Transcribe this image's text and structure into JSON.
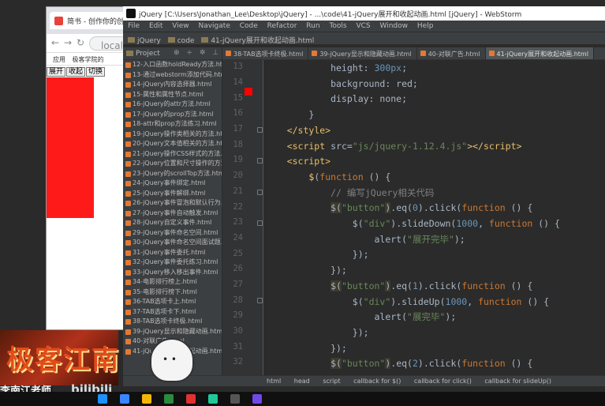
{
  "browser": {
    "tab_title": "简书 - 创作你的创作",
    "url_text": "localh",
    "bookmarks": [
      "应用",
      "极客学院的"
    ],
    "buttons": [
      "展开",
      "收起",
      "切换"
    ]
  },
  "ide": {
    "title": "jQuery [C:\\Users\\Jonathan_Lee\\Desktop\\jQuery] - ...\\code\\41-jQuery展开和收起动画.html [jQuery] - WebStorm",
    "menu": [
      "File",
      "Edit",
      "View",
      "Navigate",
      "Code",
      "Refactor",
      "Run",
      "Tools",
      "VCS",
      "Window",
      "Help"
    ],
    "nav_breadcrumbs": [
      "jQuery",
      "code",
      "41-jQuery展开和收起动画.html"
    ],
    "project_label": "Project",
    "project_tools": "⊕ ÷ ✲ ⊥",
    "files": [
      "12-入口函数holdReady方法.html",
      "13-通过webstorm添加代码.html",
      "14-jQuery内容选择器.html",
      "15-属性和属性节点.html",
      "16-jQuery的attr方法.html",
      "17-jQuery的prop方法.html",
      "18-attr和prop方法练习.html",
      "19-jQuery操作类相关的方法.html",
      "20-jQuery文本值相关的方法.html",
      "21-jQuery操作CSS样式的方法.ht",
      "22-jQuery位置和尺寸操作的方法.ht",
      "23-jQuery的scrollTop方法.html",
      "24-jQuery事件绑定.html",
      "25-jQuery事件解绑.html",
      "26-jQuery事件冒泡和默认行为.html",
      "27-jQuery事件自动触发.html",
      "28-jQuery自定义事件.html",
      "29-jQuery事件命名空间.html",
      "30-jQuery事件命名空间面试题.htm",
      "31-jQuery事件委托.html",
      "32-jQuery事件委托练习.html",
      "33-jQuery移入移出事件.html",
      "34-电影排行榜上.html",
      "35-电影排行榜下.html",
      "36-TAB选项卡上.html",
      "37-TAB选项卡下.html",
      "38-TAB选项卡终极.html",
      "39-jQuery显示和隐藏动画.html",
      "40-对联广告.html",
      "41-jQuery展开和收起动画.html"
    ],
    "tabs": [
      "38-TAB选项卡终极.html",
      "39-jQuery显示和隐藏动画.html",
      "40-对联广告.html",
      "41-jQuery展开和收起动画.html"
    ],
    "active_tab_index": 3,
    "line_numbers": [
      "13",
      "14",
      "15",
      "16",
      "17",
      "18",
      "19",
      "20",
      "21",
      "22",
      "23",
      "24",
      "25",
      "26",
      "27",
      "28",
      "29",
      "30",
      "31",
      "32"
    ],
    "status_crumbs": [
      "html",
      "head",
      "script",
      "callback for $()",
      "callback for click()",
      "callback for slideUp()"
    ]
  },
  "overlay": {
    "logo_text": "极客江南",
    "teacher_text": "李南江老师",
    "bili_text": "bilibili"
  },
  "colors": {
    "color_marker": "#ff0000",
    "red_box": "#ff1a1a",
    "keyword": "#cc7832",
    "string": "#6a8759",
    "number": "#6897bb",
    "function": "#ffc66d",
    "comment": "#808080"
  }
}
